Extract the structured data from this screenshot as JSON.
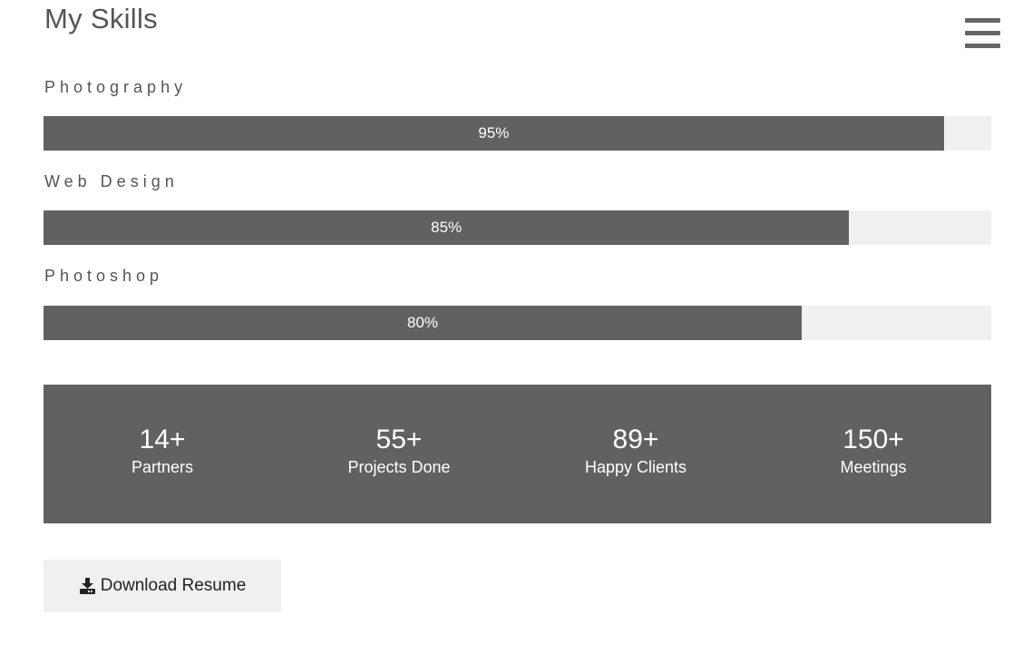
{
  "section_title": "My Skills",
  "menu": {
    "icon": "hamburger-menu-icon"
  },
  "skills": [
    {
      "label": "Photography",
      "percent": 95,
      "percent_text": "95%"
    },
    {
      "label": "Web Design",
      "percent": 85,
      "percent_text": "85%"
    },
    {
      "label": "Photoshop",
      "percent": 80,
      "percent_text": "80%"
    }
  ],
  "stats": [
    {
      "value": "14+",
      "label": "Partners"
    },
    {
      "value": "55+",
      "label": "Projects Done"
    },
    {
      "value": "89+",
      "label": "Happy Clients"
    },
    {
      "value": "150+",
      "label": "Meetings"
    }
  ],
  "download_button": {
    "label": "Download Resume",
    "icon": "download-icon"
  },
  "colors": {
    "bar_fill": "#616161",
    "bar_track": "#f0f0f0",
    "stats_background": "#616161",
    "button_background": "#f0f0f0"
  }
}
